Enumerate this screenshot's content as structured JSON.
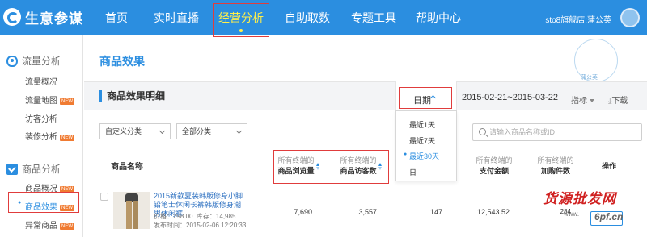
{
  "app": {
    "name": "生意参谋"
  },
  "nav": {
    "items": [
      {
        "label": "首页"
      },
      {
        "label": "实时直播"
      },
      {
        "label": "经营分析"
      },
      {
        "label": "自助取数"
      },
      {
        "label": "专题工具"
      },
      {
        "label": "帮助中心"
      }
    ],
    "account": "sto8旗舰店:蒲公英"
  },
  "sidebar": {
    "traffic": {
      "title": "流量分析",
      "items": [
        {
          "label": "流量概况",
          "badge": ""
        },
        {
          "label": "流量地图",
          "badge": "NEW"
        },
        {
          "label": "访客分析",
          "badge": ""
        },
        {
          "label": "装修分析",
          "badge": "NEW"
        }
      ]
    },
    "goods": {
      "title": "商品分析",
      "items": [
        {
          "label": "商品概况",
          "badge": "NEW"
        },
        {
          "label": "商品效果",
          "badge": "NEW"
        },
        {
          "label": "异常商品",
          "badge": "NEW"
        }
      ]
    }
  },
  "main": {
    "title": "商品效果",
    "watermark": "蒲公英",
    "detail_title": "商品效果明细",
    "date_label": "日期",
    "date_range": "2015-02-21~2015-03-22",
    "metrics_label": "指标",
    "download_label": "下载",
    "date_options": [
      {
        "label": "最近1天"
      },
      {
        "label": "最近7天"
      },
      {
        "label": "最近30天"
      },
      {
        "label": "日"
      }
    ],
    "selected_date_option": "最近30天",
    "filter_custom": "自定义分类",
    "filter_all": "全部分类",
    "search_placeholder": "请输入商品名称或ID"
  },
  "table": {
    "columns": {
      "name": "商品名称",
      "pv_sub": "所有终端的",
      "pv": "商品浏览量",
      "uv_sub": "所有终端的",
      "uv": "商品访客数",
      "pay_sub": "所有终端的",
      "pay": "支付金额",
      "cart_sub": "所有终端的",
      "cart": "加购件数",
      "action": "操作"
    },
    "row": {
      "title": "2015新款夏装韩版修身小脚铅笔士休闲长裤韩版修身潮男休闲裤",
      "price_label": "价格：",
      "price": "298.00",
      "stock_label": "库存：",
      "stock": "14,985",
      "published_label": "发布时间：",
      "published": "2015-02-06 12:20:33",
      "pv": "7,690",
      "uv": "3,557",
      "col3": "147",
      "pay": "12,543.52",
      "cart": "284"
    }
  },
  "overlay": {
    "brand": "货源批发网",
    "url_prefix": "www.",
    "url": "6pf.cn"
  },
  "colors": {
    "primary": "#2b8ee0",
    "highlight_border": "#e03c3c",
    "active_nav": "#ffef4a"
  }
}
